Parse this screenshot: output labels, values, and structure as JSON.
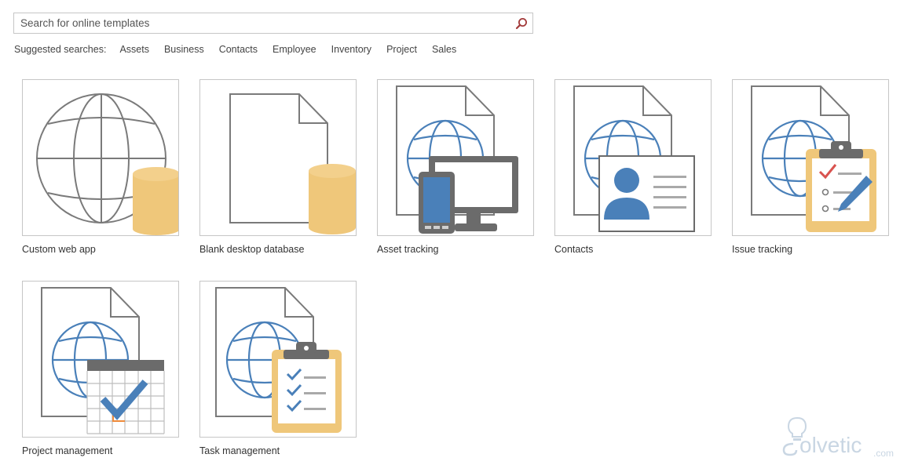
{
  "search": {
    "placeholder": "Search for online templates",
    "value": ""
  },
  "suggested": {
    "label": "Suggested searches:",
    "items": [
      "Assets",
      "Business",
      "Contacts",
      "Employee",
      "Inventory",
      "Project",
      "Sales"
    ]
  },
  "templates": [
    {
      "label": "Custom web app",
      "icon": "globe-database-icon"
    },
    {
      "label": "Blank desktop database",
      "icon": "document-database-icon"
    },
    {
      "label": "Asset tracking",
      "icon": "asset-tracking-icon"
    },
    {
      "label": "Contacts",
      "icon": "contact-card-icon"
    },
    {
      "label": "Issue tracking",
      "icon": "issue-clipboard-icon"
    },
    {
      "label": "Project management",
      "icon": "calendar-check-icon"
    },
    {
      "label": "Task management",
      "icon": "task-clipboard-icon"
    }
  ],
  "watermark": {
    "brand": "solvetic",
    "tld": ".com"
  },
  "colors": {
    "globe_blue": "#4a80b9",
    "database_gold": "#efc77a",
    "clipboard_gold": "#efc77a",
    "outline_gray": "#7a7a7a",
    "search_icon": "#a33a3a",
    "check_red": "#d9534f"
  }
}
